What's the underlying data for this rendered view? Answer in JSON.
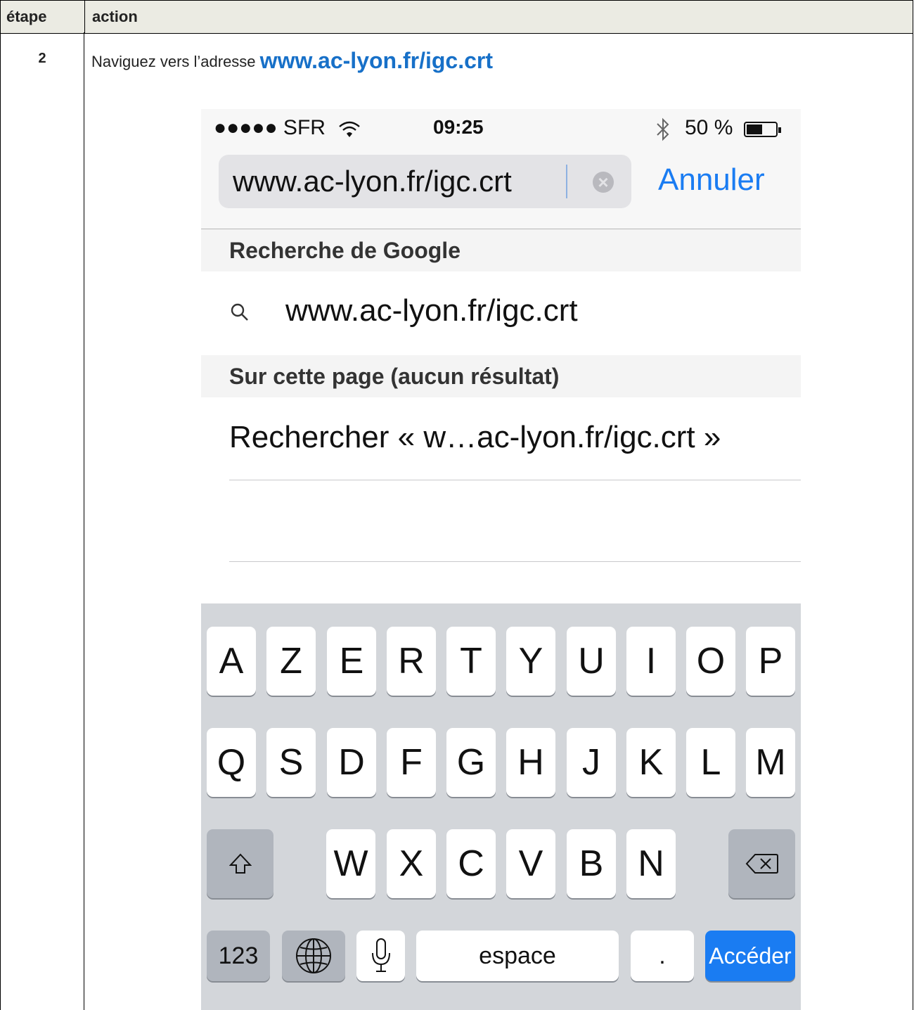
{
  "table": {
    "col_step": "étape",
    "col_action": "action",
    "row": {
      "step": "2",
      "instruction": "Naviguez vers l’adresse",
      "url": "www.ac-lyon.fr/igc.crt"
    }
  },
  "phone": {
    "status_bar": {
      "signal": "●●●●● SFR",
      "time": "09:25",
      "battery": "50 %"
    },
    "search": {
      "value": "www.ac-lyon.fr/igc.crt",
      "cancel": "Annuler"
    },
    "google_header": "Recherche de Google",
    "suggestion": "www.ac-lyon.fr/igc.crt",
    "page_header": "Sur cette page (aucun résultat)",
    "find_in_page": "Rechercher « w…ac-lyon.fr/igc.crt »",
    "keyboard": {
      "row1": [
        "A",
        "Z",
        "E",
        "R",
        "T",
        "Y",
        "U",
        "I",
        "O",
        "P"
      ],
      "row2": [
        "Q",
        "S",
        "D",
        "F",
        "G",
        "H",
        "J",
        "K",
        "L",
        "M"
      ],
      "row3": [
        "W",
        "X",
        "C",
        "V",
        "B",
        "N"
      ],
      "numbers": "123",
      "space": "espace",
      "period": ".",
      "go": "Accéder"
    },
    "icons": {
      "wifi": "wifi-icon",
      "bluetooth": "bluetooth-icon",
      "battery": "battery-icon",
      "clear": "clear-icon",
      "search": "search-icon",
      "shift": "shift-icon",
      "delete": "delete-icon",
      "globe": "globe-icon",
      "mic": "microphone-icon"
    }
  }
}
